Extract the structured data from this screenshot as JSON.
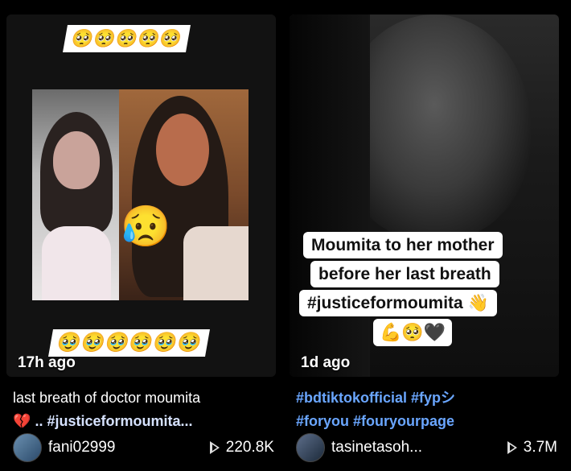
{
  "cards": [
    {
      "top_emojis": "🥺🥺🥺🥺🥺",
      "overlay_emoji": "😥",
      "bottom_emojis": "🥹🥹🥹🥹🥹🥹",
      "time_ago": "17h ago",
      "description_text": "last breath of doctor moumita",
      "description_emoji": "💔",
      "description_hashtag": ".. #justiceformoumita...",
      "username": "fani02999",
      "views": "220.8K"
    },
    {
      "caption_lines": [
        "Moumita to her mother",
        "before her last breath",
        "#justiceformoumita 👋",
        "💪🥺🖤"
      ],
      "time_ago": "1d ago",
      "description_line1": "#bdtiktokofficial #fypシ",
      "description_line2": "#foryou #fouryourpage",
      "username": "tasinetasoh...",
      "views": "3.7M"
    }
  ],
  "icons": [
    "volume-icon",
    "play-icon",
    "avatar"
  ]
}
